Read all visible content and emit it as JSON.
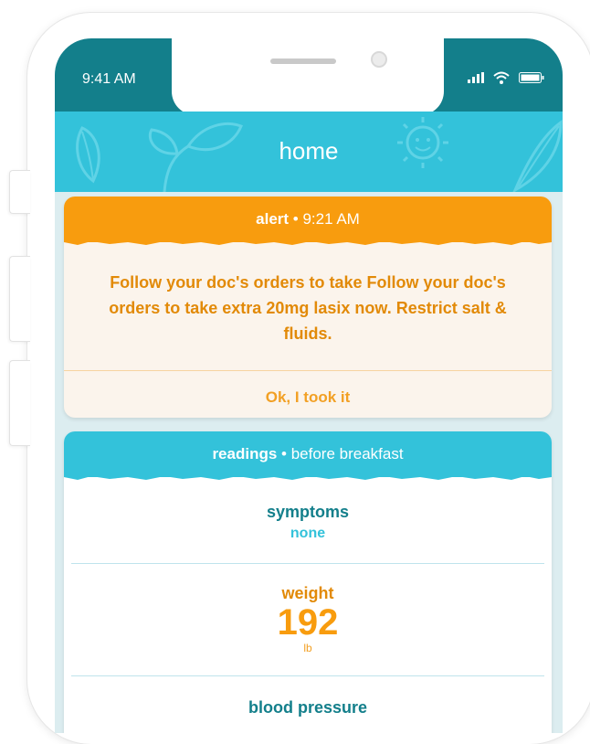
{
  "status_bar": {
    "time": "9:41 AM"
  },
  "header": {
    "title": "home"
  },
  "alert": {
    "label": "alert",
    "separator": " • ",
    "time": "9:21 AM",
    "message": "Follow your doc's orders to take Follow your doc's orders to take extra 20mg lasix now. Restrict salt & fluids.",
    "action_label": "Ok, I took it"
  },
  "readings": {
    "label": "readings",
    "separator": " • ",
    "context": "before breakfast",
    "symptoms": {
      "label": "symptoms",
      "value": "none"
    },
    "weight": {
      "label": "weight",
      "value": "192",
      "unit": "lb"
    },
    "blood_pressure": {
      "label": "blood pressure"
    }
  },
  "icons": [
    "signal-icon",
    "wifi-icon",
    "battery-icon",
    "leaf-icon",
    "sun-icon"
  ],
  "colors": {
    "status_bar": "#137f8b",
    "header": "#33c2da",
    "alert_orange": "#f89c0e",
    "alert_text": "#e28a08",
    "teal_text": "#137f8b",
    "screen_bg": "#dcedf0"
  }
}
